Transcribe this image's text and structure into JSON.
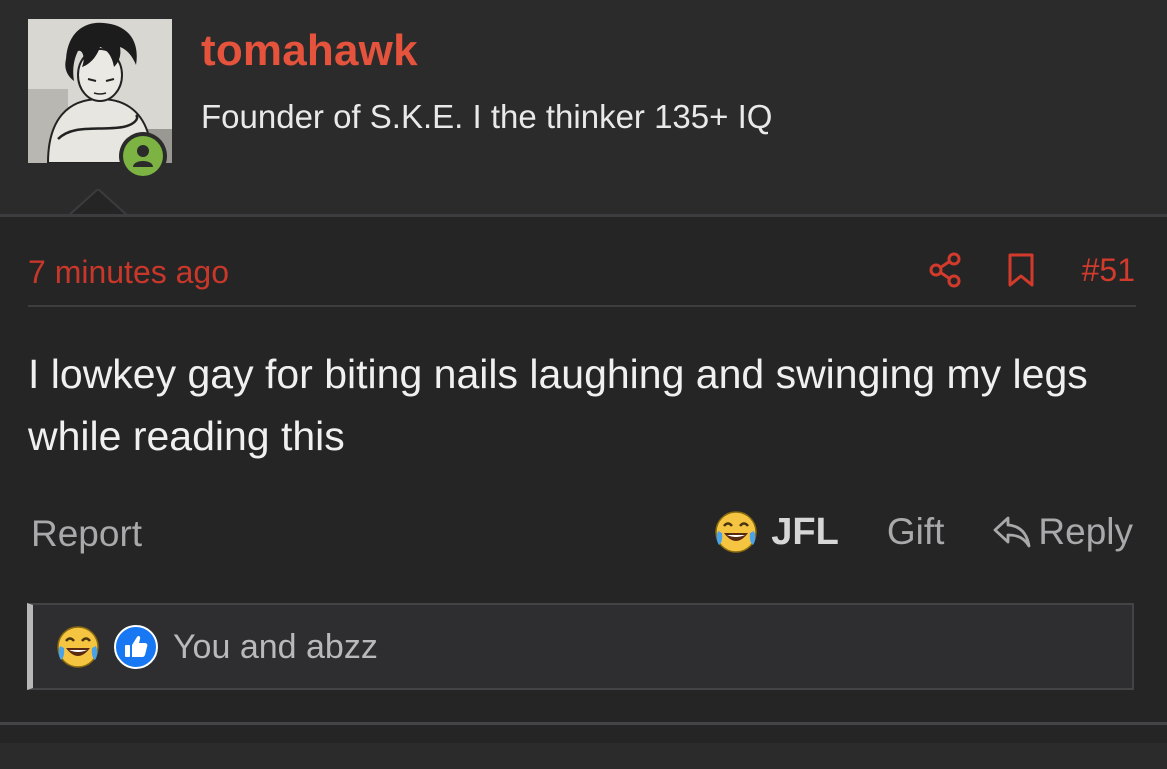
{
  "user": {
    "username": "tomahawk",
    "title": "Founder of S.K.E. I the thinker 135+ IQ",
    "online": true
  },
  "post": {
    "time": "7 minutes ago",
    "number": "#51",
    "body": "I lowkey gay for biting nails laughing and swinging my legs while reading this"
  },
  "actions": {
    "report_label": "Report",
    "jfl_label": "JFL",
    "gift_label": "Gift",
    "reply_label": "Reply"
  },
  "reactions": {
    "text": "You and abzz"
  },
  "colors": {
    "accent": "#e5533d",
    "online": "#7cb342",
    "like": "#1877f2"
  },
  "icons": [
    "share-icon",
    "bookmark-icon",
    "laughing-crying-emoji-icon",
    "reply-arrow-icon",
    "thumbs-up-icon",
    "user-icon"
  ]
}
